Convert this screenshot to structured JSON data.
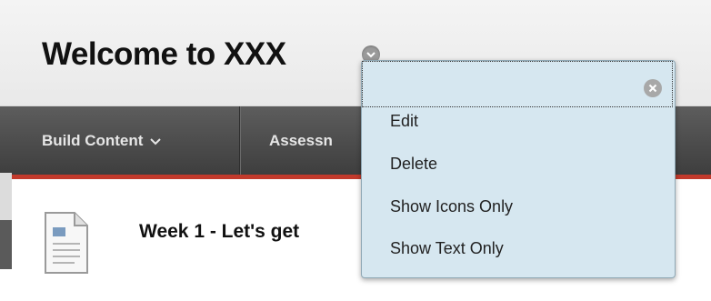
{
  "header": {
    "title": "Welcome to XXX"
  },
  "toolbar": {
    "build_content_label": "Build Content",
    "assessments_label": "Assessn"
  },
  "content": {
    "item_title": "Week 1 - Let's get"
  },
  "context_menu": {
    "items": [
      {
        "label": "Edit",
        "icon": "none"
      },
      {
        "label": "Delete",
        "icon": "none"
      },
      {
        "label": "Show Icons Only",
        "icon": "none"
      },
      {
        "label": "Show Text Only",
        "icon": "none"
      }
    ],
    "close_icon": "close-icon"
  },
  "colors": {
    "toolbar_bg": "#4a4a4a",
    "toolbar_accent": "#c23a2c",
    "menu_bg": "#d6e7f0"
  }
}
